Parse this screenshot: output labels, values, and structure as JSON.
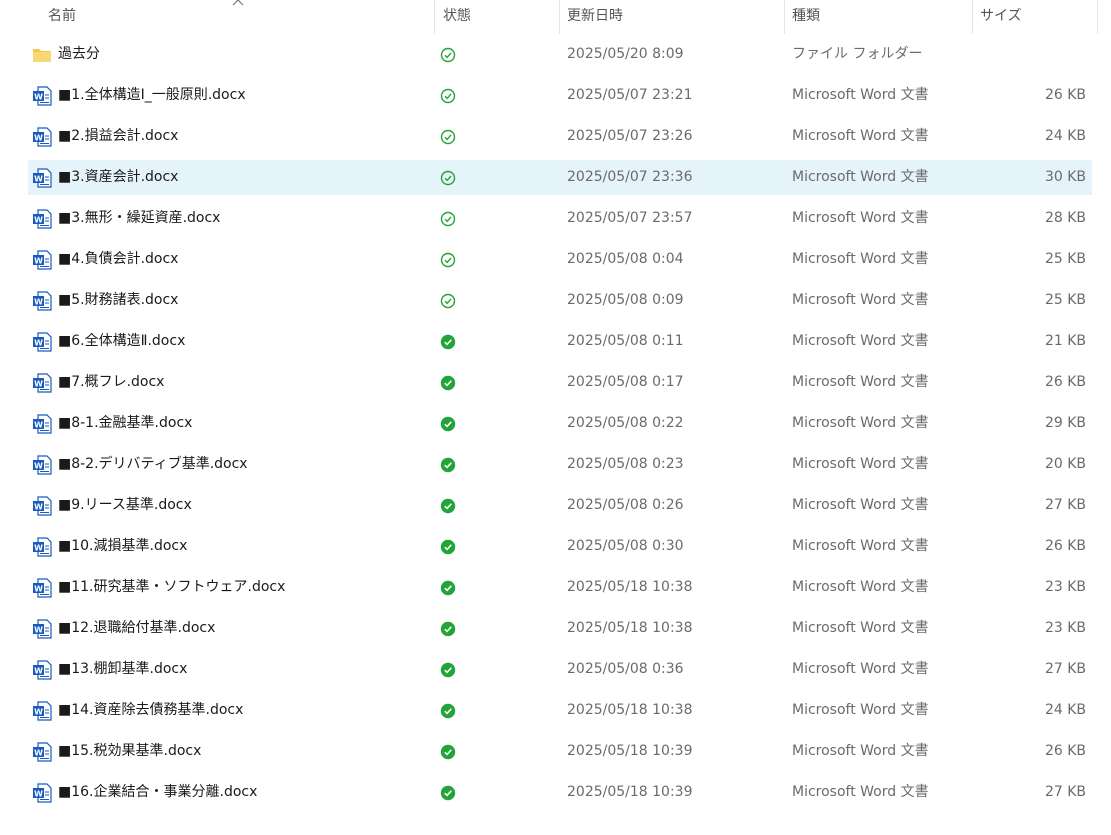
{
  "columns": {
    "name": "名前",
    "status": "状態",
    "modified": "更新日時",
    "type": "種類",
    "size": "サイズ"
  },
  "rows": [
    {
      "name": "過去分",
      "icon": "folder-icon",
      "status": "available-icon",
      "modified": "2025/05/20 8:09",
      "type": "ファイル フォルダー",
      "size": ""
    },
    {
      "name": "■1.全体構造Ⅰ_一般原則.docx",
      "icon": "word-document-icon",
      "status": "available-icon",
      "modified": "2025/05/07 23:21",
      "type": "Microsoft Word 文書",
      "size": "26 KB"
    },
    {
      "name": "■2.損益会計.docx",
      "icon": "word-document-icon",
      "status": "available-icon",
      "modified": "2025/05/07 23:26",
      "type": "Microsoft Word 文書",
      "size": "24 KB"
    },
    {
      "name": "■3.資産会計.docx",
      "icon": "word-document-icon",
      "status": "available-icon",
      "modified": "2025/05/07 23:36",
      "type": "Microsoft Word 文書",
      "size": "30 KB",
      "selected": true
    },
    {
      "name": "■3.無形・繰延資産.docx",
      "icon": "word-document-icon",
      "status": "available-icon",
      "modified": "2025/05/07 23:57",
      "type": "Microsoft Word 文書",
      "size": "28 KB"
    },
    {
      "name": "■4.負債会計.docx",
      "icon": "word-document-icon",
      "status": "available-icon",
      "modified": "2025/05/08 0:04",
      "type": "Microsoft Word 文書",
      "size": "25 KB"
    },
    {
      "name": "■5.財務諸表.docx",
      "icon": "word-document-icon",
      "status": "available-icon",
      "modified": "2025/05/08 0:09",
      "type": "Microsoft Word 文書",
      "size": "25 KB"
    },
    {
      "name": "■6.全体構造Ⅱ.docx",
      "icon": "word-document-icon",
      "status": "synced-icon",
      "modified": "2025/05/08 0:11",
      "type": "Microsoft Word 文書",
      "size": "21 KB"
    },
    {
      "name": "■7.概フレ.docx",
      "icon": "word-document-icon",
      "status": "synced-icon",
      "modified": "2025/05/08 0:17",
      "type": "Microsoft Word 文書",
      "size": "26 KB"
    },
    {
      "name": "■8-1.金融基準.docx",
      "icon": "word-document-icon",
      "status": "synced-icon",
      "modified": "2025/05/08 0:22",
      "type": "Microsoft Word 文書",
      "size": "29 KB"
    },
    {
      "name": "■8-2.デリバティブ基準.docx",
      "icon": "word-document-icon",
      "status": "synced-icon",
      "modified": "2025/05/08 0:23",
      "type": "Microsoft Word 文書",
      "size": "20 KB"
    },
    {
      "name": "■9.リース基準.docx",
      "icon": "word-document-icon",
      "status": "synced-icon",
      "modified": "2025/05/08 0:26",
      "type": "Microsoft Word 文書",
      "size": "27 KB"
    },
    {
      "name": "■10.減損基準.docx",
      "icon": "word-document-icon",
      "status": "synced-icon",
      "modified": "2025/05/08 0:30",
      "type": "Microsoft Word 文書",
      "size": "26 KB"
    },
    {
      "name": "■11.研究基準・ソフトウェア.docx",
      "icon": "word-document-icon",
      "status": "synced-icon",
      "modified": "2025/05/18 10:38",
      "type": "Microsoft Word 文書",
      "size": "23 KB"
    },
    {
      "name": "■12.退職給付基準.docx",
      "icon": "word-document-icon",
      "status": "synced-icon",
      "modified": "2025/05/18 10:38",
      "type": "Microsoft Word 文書",
      "size": "23 KB"
    },
    {
      "name": "■13.棚卸基準.docx",
      "icon": "word-document-icon",
      "status": "synced-icon",
      "modified": "2025/05/08 0:36",
      "type": "Microsoft Word 文書",
      "size": "27 KB"
    },
    {
      "name": "■14.資産除去債務基準.docx",
      "icon": "word-document-icon",
      "status": "synced-icon",
      "modified": "2025/05/18 10:38",
      "type": "Microsoft Word 文書",
      "size": "24 KB"
    },
    {
      "name": "■15.税効果基準.docx",
      "icon": "word-document-icon",
      "status": "synced-icon",
      "modified": "2025/05/18 10:39",
      "type": "Microsoft Word 文書",
      "size": "26 KB"
    },
    {
      "name": "■16.企業結合・事業分離.docx",
      "icon": "word-document-icon",
      "status": "synced-icon",
      "modified": "2025/05/18 10:39",
      "type": "Microsoft Word 文書",
      "size": "27 KB"
    }
  ],
  "colors": {
    "selected_row": "#e5f3fb",
    "status_green": "#22a538",
    "word_blue": "#185abd",
    "folder_yellow": "#f4c84a"
  }
}
